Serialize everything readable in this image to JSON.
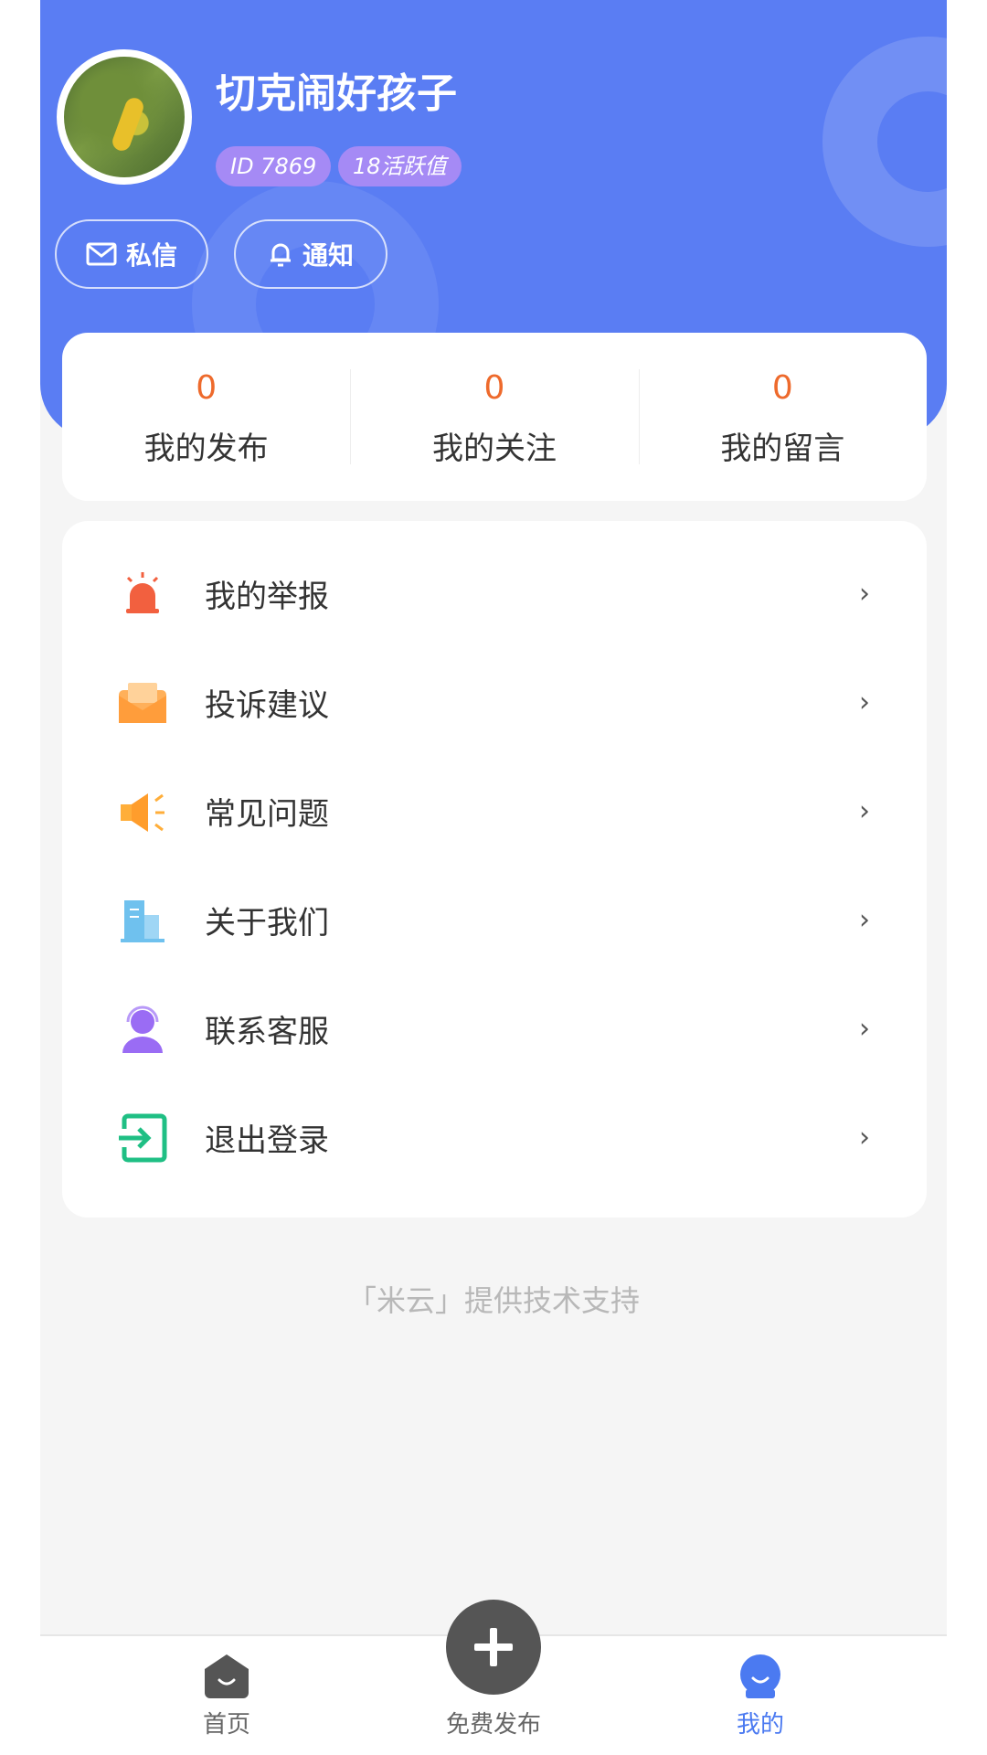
{
  "profile": {
    "username": "切克闹好孩子",
    "badge_id": "ID 7869",
    "badge_activity": "18活跃值",
    "avatar": "profile-photo"
  },
  "actions": {
    "message_label": "私信",
    "message_icon": "mail-icon",
    "notice_label": "通知",
    "notice_icon": "bell-icon"
  },
  "stats": [
    {
      "value": "0",
      "label": "我的发布"
    },
    {
      "value": "0",
      "label": "我的关注"
    },
    {
      "value": "0",
      "label": "我的留言"
    }
  ],
  "menu": [
    {
      "label": "我的举报",
      "icon": "alarm-icon",
      "color": "#f2603f"
    },
    {
      "label": "投诉建议",
      "icon": "envelope-icon",
      "color": "#ffb05a"
    },
    {
      "label": "常见问题",
      "icon": "megaphone-icon",
      "color": "#ffae3a"
    },
    {
      "label": "关于我们",
      "icon": "building-icon",
      "color": "#6fc1ee"
    },
    {
      "label": "联系客服",
      "icon": "customer-service-icon",
      "color": "#9a6cf4"
    },
    {
      "label": "退出登录",
      "icon": "logout-icon",
      "color": "#1fbf84"
    }
  ],
  "footer": {
    "support_text": "「米云」提供技术支持"
  },
  "tabbar": {
    "home_label": "首页",
    "post_label": "免费发布",
    "mine_label": "我的",
    "active_color": "#4b7af1"
  },
  "theme": {
    "header_blue": "#5a7df3",
    "stat_orange": "#ee6a2c",
    "badge_purple": "#a58af5"
  }
}
